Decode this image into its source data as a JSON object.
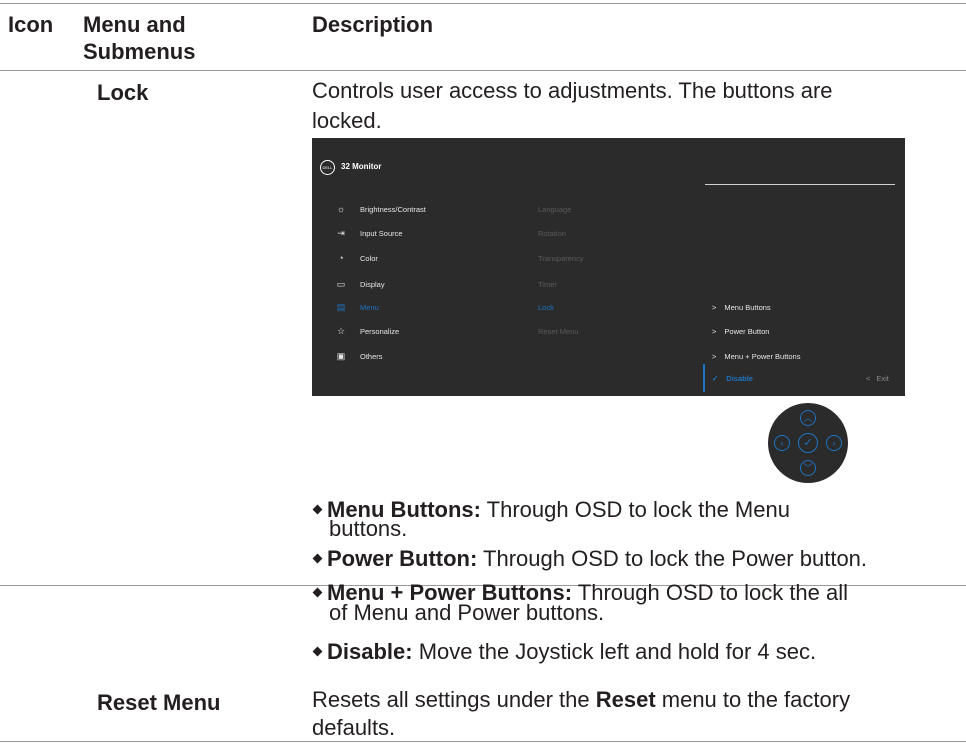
{
  "header": {
    "col_icon": "Icon",
    "col_menu_line1": "Menu and",
    "col_menu_line2": "Submenus",
    "col_desc": "Description"
  },
  "rows": {
    "lock": {
      "name": "Lock",
      "desc_line1": "Controls user access to adjustments. The buttons are",
      "desc_line2": "locked."
    },
    "reset": {
      "name": "Reset Menu",
      "desc_prefix": "Resets all settings under the ",
      "desc_bold": "Reset",
      "desc_suffix": " menu to the factory",
      "desc_line2": "defaults."
    }
  },
  "osd": {
    "logo": "DELL",
    "title": "32 Monitor",
    "menu": [
      {
        "icon": "brightness-icon",
        "glyph": "☼",
        "label": "Brightness/Contrast"
      },
      {
        "icon": "input-source-icon",
        "glyph": "⇥",
        "label": "Input Source"
      },
      {
        "icon": "color-icon",
        "glyph": "◔",
        "label": "Color"
      },
      {
        "icon": "display-icon",
        "glyph": "▭",
        "label": "Display"
      },
      {
        "icon": "menu-icon",
        "glyph": "▤",
        "label": "Menu"
      },
      {
        "icon": "personalize-icon",
        "glyph": "☆",
        "label": "Personalize"
      },
      {
        "icon": "others-icon",
        "glyph": "▣",
        "label": "Others"
      }
    ],
    "submenu": [
      "Language",
      "Rotation",
      "Transparency",
      "Timer",
      "Lock",
      "Reset Menu"
    ],
    "options": [
      "Menu Buttons",
      "Power Button",
      "Menu + Power Buttons"
    ],
    "selected_option": "Disable",
    "exit_label": "Exit",
    "accent_color": "#1e74c2"
  },
  "bullets": [
    {
      "bold": "Menu Buttons:",
      "text": " Through OSD to lock the Menu",
      "cont": "buttons."
    },
    {
      "bold": "Power Button:",
      "text": " Through OSD to lock the Power button.",
      "cont": ""
    },
    {
      "bold": "Menu + Power Buttons:",
      "text": " Through OSD to lock the all",
      "cont": "of Menu and Power buttons."
    },
    {
      "bold": "Disable:",
      "text": " Move the Joystick left and hold for 4 sec.",
      "cont": ""
    }
  ]
}
